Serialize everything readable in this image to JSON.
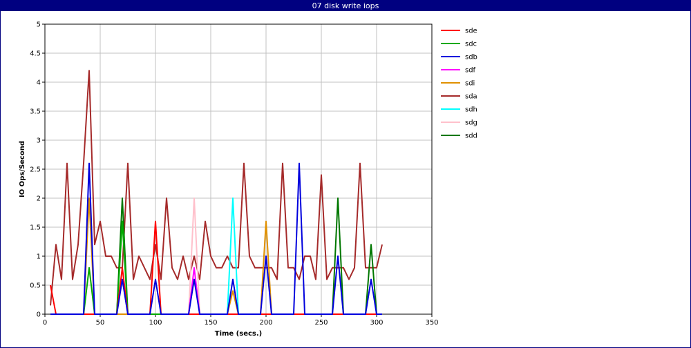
{
  "window": {
    "title": "07 disk write iops"
  },
  "chart_data": {
    "type": "line",
    "title": "07 disk write iops",
    "xlabel": "Time (secs.)",
    "ylabel": "IO Ops/Second",
    "xlim": [
      0,
      350
    ],
    "ylim": [
      0,
      5
    ],
    "xticks": [
      0,
      50,
      100,
      150,
      200,
      250,
      300,
      350
    ],
    "yticks": [
      0,
      0.5,
      1,
      1.5,
      2,
      2.5,
      3,
      3.5,
      4,
      4.5,
      5
    ],
    "grid": true,
    "legend_position": "right",
    "series": [
      {
        "name": "sde",
        "color": "#ff0000",
        "points": [
          [
            5,
            0.5
          ],
          [
            10,
            0
          ],
          [
            40,
            0
          ],
          [
            65,
            0
          ],
          [
            70,
            0.8
          ],
          [
            75,
            0
          ],
          [
            95,
            0
          ],
          [
            100,
            1.6
          ],
          [
            105,
            0
          ],
          [
            305,
            0
          ]
        ]
      },
      {
        "name": "sdc",
        "color": "#00aa00",
        "points": [
          [
            5,
            0
          ],
          [
            35,
            0
          ],
          [
            40,
            0.8
          ],
          [
            45,
            0
          ],
          [
            65,
            0
          ],
          [
            70,
            1.6
          ],
          [
            75,
            0
          ],
          [
            305,
            0
          ]
        ]
      },
      {
        "name": "sdb",
        "color": "#0000dd",
        "points": [
          [
            5,
            0
          ],
          [
            35,
            0
          ],
          [
            40,
            2.6
          ],
          [
            45,
            0
          ],
          [
            65,
            0
          ],
          [
            70,
            0.6
          ],
          [
            75,
            0
          ],
          [
            95,
            0
          ],
          [
            100,
            0.6
          ],
          [
            105,
            0
          ],
          [
            130,
            0
          ],
          [
            135,
            0.6
          ],
          [
            140,
            0
          ],
          [
            165,
            0
          ],
          [
            170,
            0.6
          ],
          [
            175,
            0
          ],
          [
            195,
            0
          ],
          [
            200,
            1.0
          ],
          [
            205,
            0
          ],
          [
            225,
            0
          ],
          [
            230,
            2.6
          ],
          [
            235,
            0
          ],
          [
            260,
            0
          ],
          [
            265,
            1.0
          ],
          [
            270,
            0
          ],
          [
            290,
            0
          ],
          [
            295,
            0.6
          ],
          [
            300,
            0
          ],
          [
            305,
            0
          ]
        ]
      },
      {
        "name": "sdf",
        "color": "#ff00ff",
        "points": [
          [
            5,
            0
          ],
          [
            130,
            0
          ],
          [
            135,
            0.8
          ],
          [
            140,
            0
          ],
          [
            305,
            0
          ]
        ]
      },
      {
        "name": "sdi",
        "color": "#e09000",
        "points": [
          [
            5,
            0
          ],
          [
            35,
            0
          ],
          [
            40,
            2.0
          ],
          [
            45,
            0
          ],
          [
            165,
            0
          ],
          [
            170,
            0.4
          ],
          [
            175,
            0
          ],
          [
            195,
            0
          ],
          [
            200,
            1.6
          ],
          [
            205,
            0
          ],
          [
            305,
            0
          ]
        ]
      },
      {
        "name": "sda",
        "color": "#a52a2a",
        "points": [
          [
            5,
            0.15
          ],
          [
            10,
            1.2
          ],
          [
            15,
            0.6
          ],
          [
            20,
            2.6
          ],
          [
            25,
            0.6
          ],
          [
            30,
            1.2
          ],
          [
            35,
            2.6
          ],
          [
            40,
            4.2
          ],
          [
            45,
            1.2
          ],
          [
            50,
            1.6
          ],
          [
            55,
            1.0
          ],
          [
            60,
            1.0
          ],
          [
            65,
            0.8
          ],
          [
            70,
            0.8
          ],
          [
            75,
            2.6
          ],
          [
            80,
            0.6
          ],
          [
            85,
            1.0
          ],
          [
            90,
            0.8
          ],
          [
            95,
            0.6
          ],
          [
            100,
            1.2
          ],
          [
            105,
            0.6
          ],
          [
            110,
            2.0
          ],
          [
            115,
            0.8
          ],
          [
            120,
            0.6
          ],
          [
            125,
            1.0
          ],
          [
            130,
            0.6
          ],
          [
            135,
            1.0
          ],
          [
            140,
            0.6
          ],
          [
            145,
            1.6
          ],
          [
            150,
            1.0
          ],
          [
            155,
            0.8
          ],
          [
            160,
            0.8
          ],
          [
            165,
            1.0
          ],
          [
            170,
            0.8
          ],
          [
            175,
            0.8
          ],
          [
            180,
            2.6
          ],
          [
            185,
            1.0
          ],
          [
            190,
            0.8
          ],
          [
            195,
            0.8
          ],
          [
            200,
            0.8
          ],
          [
            205,
            0.8
          ],
          [
            210,
            0.6
          ],
          [
            215,
            2.6
          ],
          [
            220,
            0.8
          ],
          [
            225,
            0.8
          ],
          [
            230,
            0.6
          ],
          [
            235,
            1.0
          ],
          [
            240,
            1.0
          ],
          [
            245,
            0.6
          ],
          [
            250,
            2.4
          ],
          [
            255,
            0.6
          ],
          [
            260,
            0.8
          ],
          [
            265,
            0.8
          ],
          [
            270,
            0.8
          ],
          [
            275,
            0.6
          ],
          [
            280,
            0.8
          ],
          [
            285,
            2.6
          ],
          [
            290,
            0.8
          ],
          [
            295,
            0.8
          ],
          [
            300,
            0.8
          ],
          [
            305,
            1.2
          ]
        ]
      },
      {
        "name": "sdh",
        "color": "#00ffff",
        "points": [
          [
            5,
            0
          ],
          [
            165,
            0
          ],
          [
            170,
            2.0
          ],
          [
            175,
            0
          ],
          [
            305,
            0
          ]
        ]
      },
      {
        "name": "sdg",
        "color": "#ffc0cb",
        "points": [
          [
            5,
            0
          ],
          [
            130,
            0
          ],
          [
            135,
            2.0
          ],
          [
            140,
            0
          ],
          [
            305,
            0
          ]
        ]
      },
      {
        "name": "sdd",
        "color": "#007700",
        "points": [
          [
            5,
            0
          ],
          [
            65,
            0
          ],
          [
            70,
            2.0
          ],
          [
            75,
            0
          ],
          [
            260,
            0
          ],
          [
            265,
            2.0
          ],
          [
            270,
            0
          ],
          [
            290,
            0
          ],
          [
            295,
            1.2
          ],
          [
            300,
            0
          ],
          [
            305,
            0
          ]
        ]
      }
    ]
  }
}
